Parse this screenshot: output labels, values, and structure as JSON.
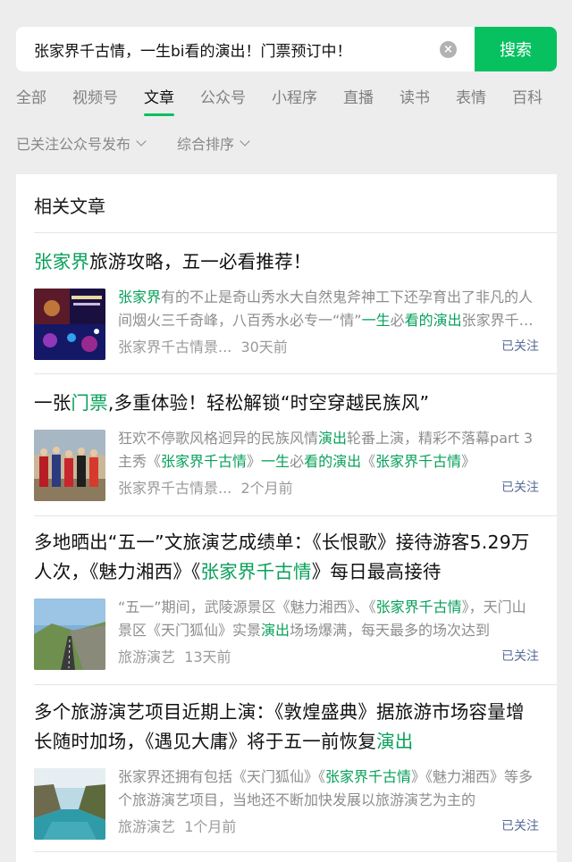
{
  "search": {
    "query": "张家界千古情，一生bi看的演出！门票预订中！",
    "button_label": "搜索",
    "clear_icon": "clear-icon"
  },
  "tabs": [
    {
      "label": "全部",
      "active": false
    },
    {
      "label": "视频号",
      "active": false
    },
    {
      "label": "文章",
      "active": true
    },
    {
      "label": "公众号",
      "active": false
    },
    {
      "label": "小程序",
      "active": false
    },
    {
      "label": "直播",
      "active": false
    },
    {
      "label": "读书",
      "active": false
    },
    {
      "label": "表情",
      "active": false
    },
    {
      "label": "百科",
      "active": false
    }
  ],
  "filters": [
    {
      "label": "已关注公众号发布"
    },
    {
      "label": "综合排序"
    }
  ],
  "section_title": "相关文章",
  "articles": [
    {
      "title_html": "<span class=\"hl\">张家界</span>旅游攻略，五一必看推荐！",
      "desc_html": "<span class=\"hl\">张家界</span>有的不止是奇山秀水大自然鬼斧神工下还孕育出了非凡的人间烟火三千奇峰，八百秀水必专一“情”<span class=\"hl\">一生</span>必<span class=\"hl\">看的演出</span>张家界千古情",
      "source": "张家界千古情景...",
      "time": "30天前",
      "follow": "已关注",
      "thumb": "night-show"
    },
    {
      "title_html": "一张<span class=\"hl\">门票</span>,多重体验！轻松解锁“时空穿越民族风”",
      "desc_html": "狂欢不停歌风格迥异的民族风情<span class=\"hl\">演出</span>轮番上演，精彩不落幕part 3主秀《<span class=\"hl\">张家界千古情</span>》<span class=\"hl\">一生</span>必<span class=\"hl\">看的演出</span>《<span class=\"hl\">张家界千古情</span>》",
      "source": "张家界千古情景...",
      "time": "2个月前",
      "follow": "已关注",
      "thumb": "folk-dance"
    },
    {
      "title_html": "多地晒出“五一”文旅演艺成绩单：《长恨歌》接待游客5.29万人次，《魅力湘西》《<span class=\"hl\">张家界千古情</span>》每日最高接待",
      "desc_html": "“五一”期间，武陵源景区《魅力湘西》、《<span class=\"hl\">张家界千古情</span>》，天门山景区《天门狐仙》实景<span class=\"hl\">演出</span>场场爆满，每天最多的场次达到",
      "source": "旅游演艺",
      "time": "13天前",
      "follow": "已关注",
      "thumb": "mountain-road"
    },
    {
      "title_html": "多个旅游演艺项目近期上演：《敦煌盛典》据旅游市场容量增长随时加场，《遇见大庸》将于五一前恢复<span class=\"hl\">演出</span>",
      "desc_html": "张家界还拥有包括《天门狐仙》《<span class=\"hl\">张家界千古情</span>》《魅力湘西》等多个旅游演艺项目，当地还不断加快发展以旅游演艺为主的",
      "source": "旅游演艺",
      "time": "1个月前",
      "follow": "已关注",
      "thumb": "river-canyon"
    }
  ]
}
